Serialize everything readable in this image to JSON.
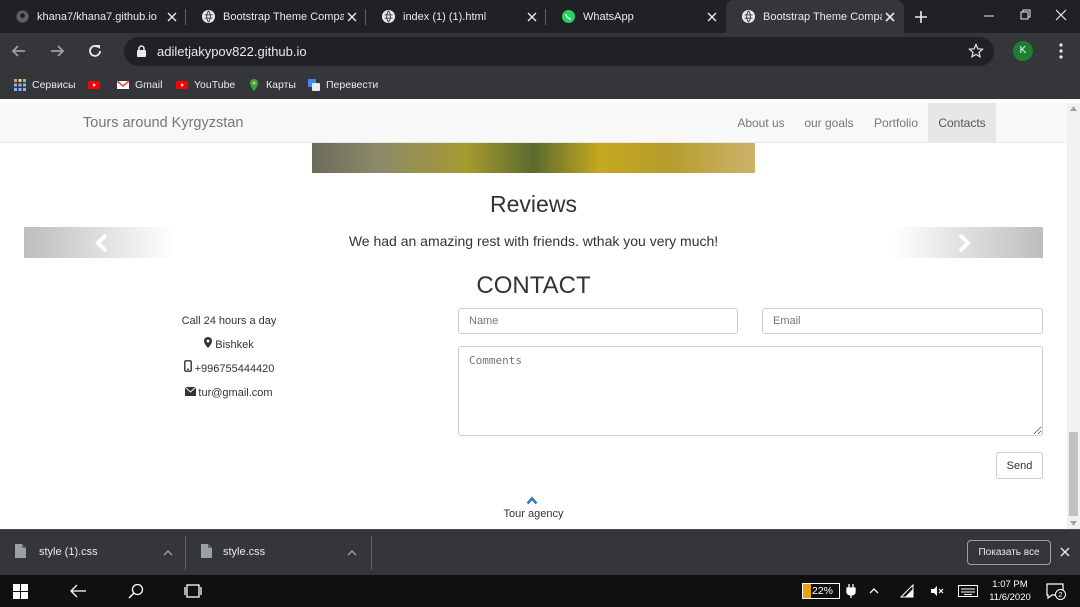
{
  "browser": {
    "tabs": [
      {
        "title": "khana7/khana7.github.io",
        "favicon": "github-icon"
      },
      {
        "title": "Bootstrap Theme Company Pa",
        "favicon": "globe-icon"
      },
      {
        "title": "index (1) (1).html",
        "favicon": "globe-icon"
      },
      {
        "title": "WhatsApp",
        "favicon": "whatsapp-icon"
      },
      {
        "title": "Bootstrap Theme Company Pa",
        "favicon": "globe-icon"
      }
    ],
    "url": "adiletjakypov822.github.io",
    "profile_initial": "K",
    "bookmarks": [
      {
        "label": "Сервисы"
      },
      {
        "label": ""
      },
      {
        "label": "Gmail"
      },
      {
        "label": "YouTube"
      },
      {
        "label": "Карты"
      },
      {
        "label": "Перевести"
      }
    ]
  },
  "page": {
    "brand": "Tours around Kyrgyzstan",
    "nav": [
      "About us",
      "our goals",
      "Portfolio",
      "Contacts"
    ],
    "reviews_title": "Reviews",
    "review_text": "We had an amazing rest with friends. wthak you very much!",
    "contact_title": "CONTACT",
    "contact_info": {
      "hours": "Call 24 hours a day",
      "city": "Bishkek",
      "phone": "+996755444420",
      "email": "tur@gmail.com"
    },
    "form": {
      "name_placeholder": "Name",
      "email_placeholder": "Email",
      "comments_placeholder": "Comments",
      "send_label": "Send"
    },
    "footer_text": "Tour agency"
  },
  "downloads": {
    "items": [
      {
        "name": "style (1).css"
      },
      {
        "name": "style.css"
      }
    ],
    "show_all": "Показать все"
  },
  "taskbar": {
    "battery": "22%",
    "time": "1:07 PM",
    "date": "11/6/2020",
    "notifications": "2"
  }
}
